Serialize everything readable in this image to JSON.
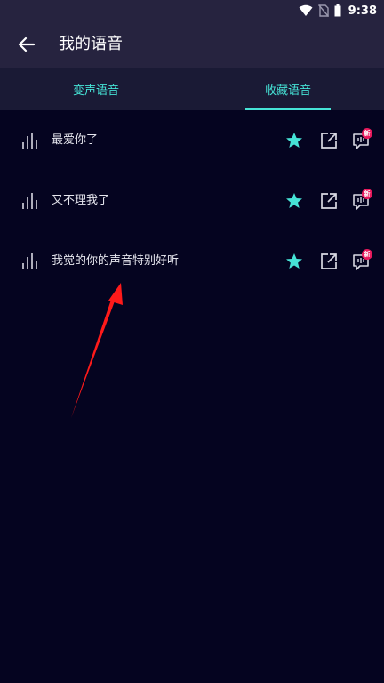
{
  "status_bar": {
    "time": "9:38",
    "icons": [
      "wifi-icon",
      "no-sim-icon",
      "battery-icon"
    ]
  },
  "app_bar": {
    "title": "我的语音",
    "back_icon": "arrow-left-icon"
  },
  "tabs": [
    {
      "label": "变声语音"
    },
    {
      "label": "收藏语音"
    }
  ],
  "voice_list": [
    {
      "label": "最爱你了",
      "badge": "新"
    },
    {
      "label": "又不理我了",
      "badge": "新"
    },
    {
      "label": "我觉的你的声音特别好听",
      "badge": "新"
    }
  ],
  "colors": {
    "accent": "#46e3d6",
    "badge": "#e8195c",
    "background": "#050420",
    "app_bar": "#26233f",
    "tab_bar": "#1a1a35",
    "annotation_arrow": "#ff1a1a"
  }
}
